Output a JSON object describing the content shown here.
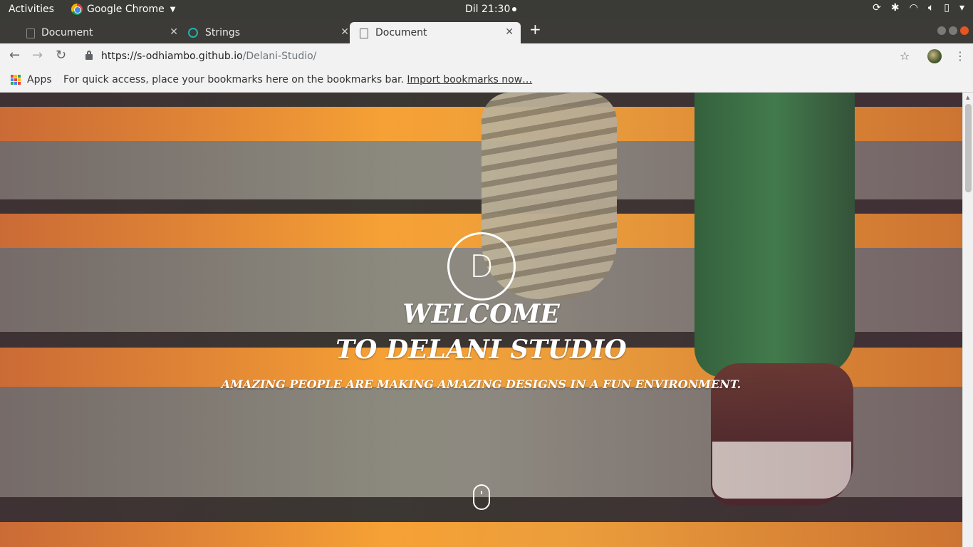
{
  "system_bar": {
    "activities": "Activities",
    "app_name": "Google Chrome",
    "clock": "Dil 21:30"
  },
  "tabs": [
    {
      "title": "Document",
      "active": false
    },
    {
      "title": "Strings",
      "active": false
    },
    {
      "title": "Document",
      "active": true
    }
  ],
  "toolbar": {
    "url_host": "https://s-odhiambo.github.io",
    "url_path": "/Delani-Studio/"
  },
  "bookmarks_bar": {
    "apps_label": "Apps",
    "message": "For quick access, place your bookmarks here on the bookmarks bar.",
    "import_link": "Import bookmarks now…"
  },
  "page": {
    "logo_letter": "D",
    "heading_line1": "WELCOME",
    "heading_line2": "TO DELANI STUDIO",
    "tagline": "AMAZING PEOPLE ARE MAKING AMAZING DESIGNS IN A FUN ENVIRONMENT."
  },
  "icons": {
    "apps_grid_colors": [
      "#ea4335",
      "#fbbc05",
      "#34a853",
      "#4285f4",
      "#ea4335",
      "#fbbc05",
      "#34a853",
      "#4285f4",
      "#ea4335"
    ]
  }
}
